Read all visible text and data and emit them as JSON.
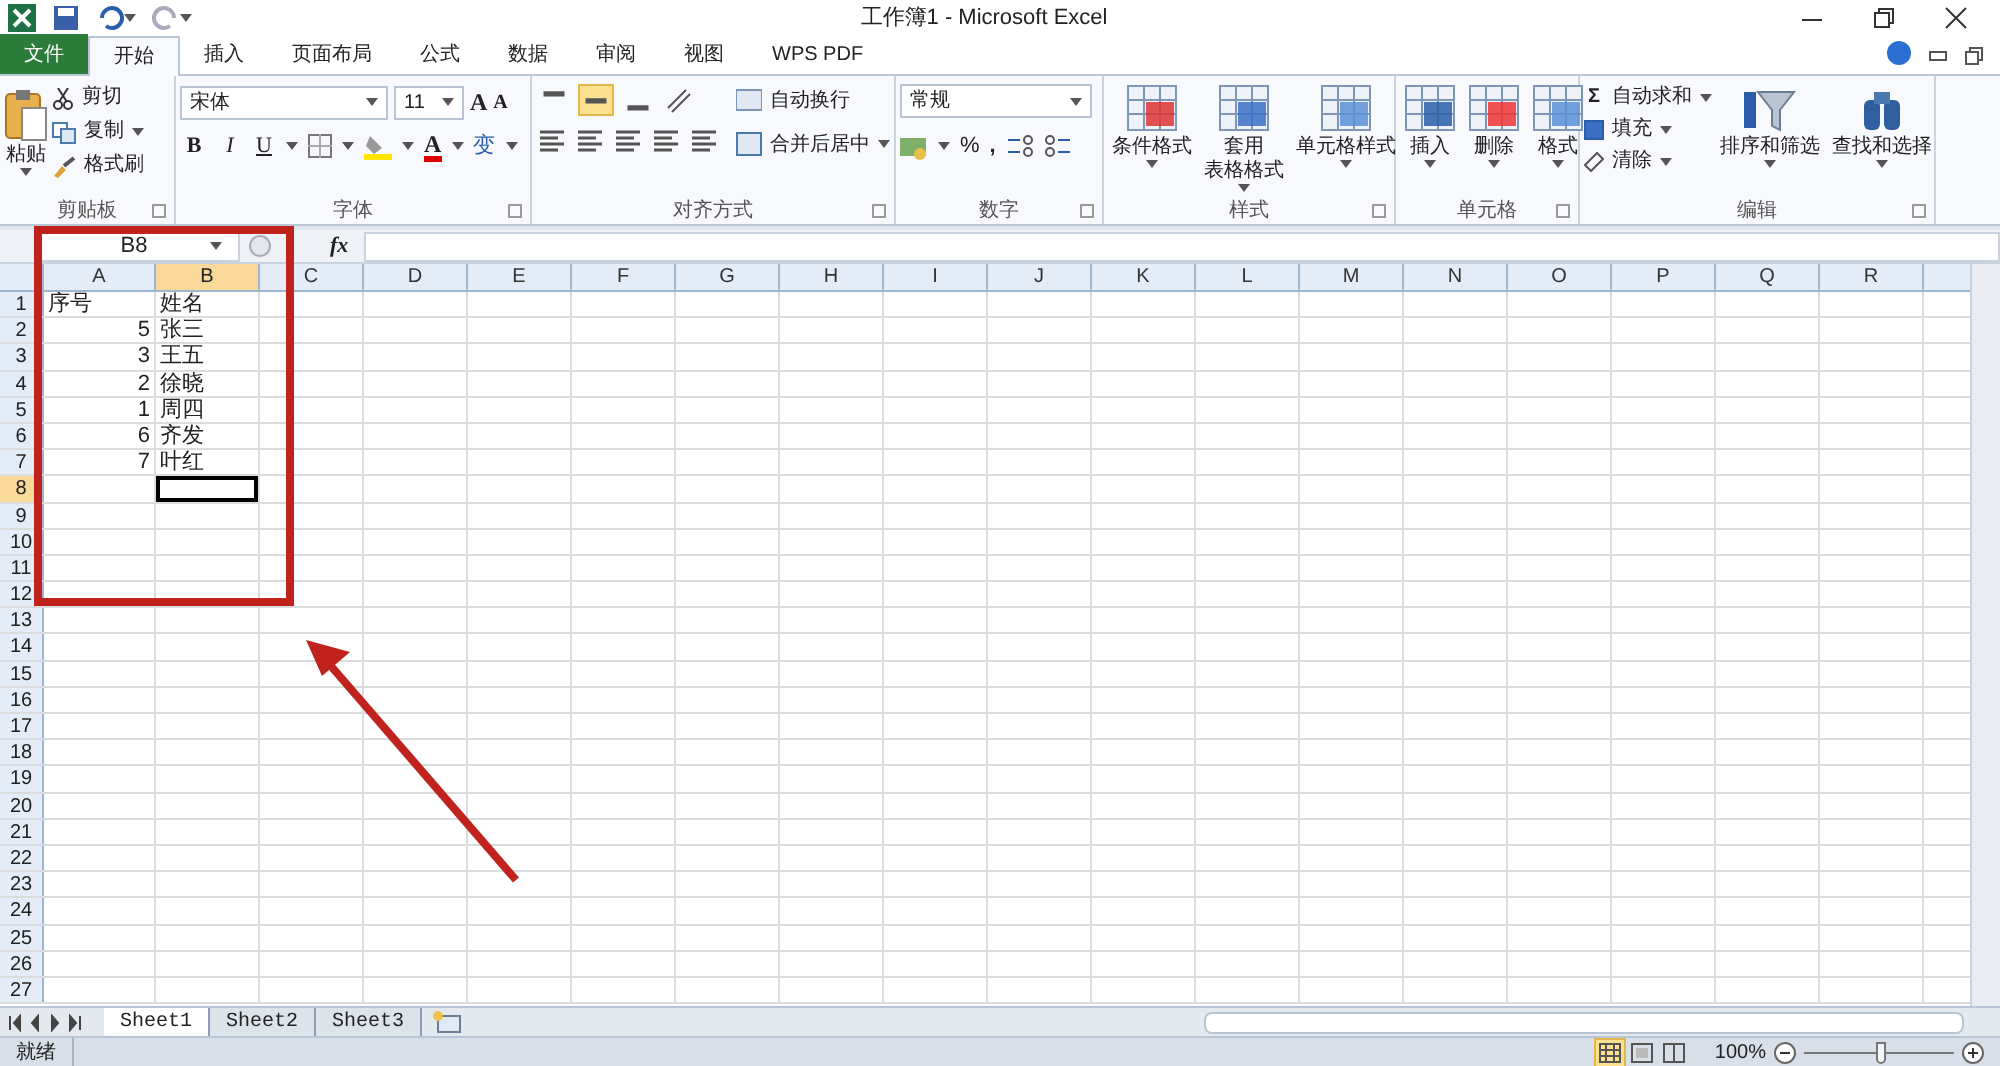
{
  "title": "工作簿1 - Microsoft Excel",
  "tabs": [
    {
      "label": "文件",
      "kind": "file",
      "selected": false
    },
    {
      "label": "开始",
      "kind": "tab",
      "selected": true
    },
    {
      "label": "插入",
      "kind": "tab",
      "selected": false
    },
    {
      "label": "页面布局",
      "kind": "tab",
      "selected": false
    },
    {
      "label": "公式",
      "kind": "tab",
      "selected": false
    },
    {
      "label": "数据",
      "kind": "tab",
      "selected": false
    },
    {
      "label": "审阅",
      "kind": "tab",
      "selected": false
    },
    {
      "label": "视图",
      "kind": "tab",
      "selected": false
    },
    {
      "label": "WPS PDF",
      "kind": "tab",
      "selected": false
    }
  ],
  "ribbon": {
    "clipboard": {
      "label": "剪贴板",
      "paste": "粘贴",
      "cut": "剪切",
      "copy": "复制",
      "format_painter": "格式刷"
    },
    "font": {
      "label": "字体",
      "font_name": "宋体",
      "font_size": "11",
      "grow_font": "A",
      "shrink_font": "A",
      "bold": "B",
      "italic": "I",
      "underline": "U",
      "font_color": "A",
      "phonetic": "变"
    },
    "alignment": {
      "label": "对齐方式",
      "wrap": "自动换行",
      "merge": "合并后居中",
      "middle_align_selected": true
    },
    "number": {
      "label": "数字",
      "format": "常规",
      "percent": "%",
      "comma": ","
    },
    "styles": {
      "label": "样式",
      "buttons": [
        [
          "条件格式"
        ],
        [
          "套用",
          "表格格式"
        ],
        [
          "单元格样式"
        ]
      ]
    },
    "cells": {
      "label": "单元格",
      "buttons": [
        "插入",
        "删除",
        "格式"
      ]
    },
    "editing": {
      "label": "编辑",
      "autosum_sign": "Σ",
      "autosum": "自动求和",
      "fill": "填充",
      "clear": "清除",
      "sort": "排序和筛选",
      "find": "查找和选择"
    }
  },
  "formula_bar": {
    "name_box": "B8",
    "fx": "fx"
  },
  "grid": {
    "columns": [
      {
        "label": "A",
        "selected": false
      },
      {
        "label": "B",
        "selected": true
      },
      {
        "label": "C",
        "selected": false
      },
      {
        "label": "D",
        "selected": false
      },
      {
        "label": "E",
        "selected": false
      },
      {
        "label": "F",
        "selected": false
      },
      {
        "label": "G",
        "selected": false
      },
      {
        "label": "H",
        "selected": false
      },
      {
        "label": "I",
        "selected": false
      },
      {
        "label": "J",
        "selected": false
      },
      {
        "label": "K",
        "selected": false
      },
      {
        "label": "L",
        "selected": false
      },
      {
        "label": "M",
        "selected": false
      },
      {
        "label": "N",
        "selected": false
      },
      {
        "label": "O",
        "selected": false
      },
      {
        "label": "P",
        "selected": false
      },
      {
        "label": "Q",
        "selected": false
      },
      {
        "label": "R",
        "selected": false
      }
    ],
    "rows": [
      {
        "label": "1",
        "selected": false,
        "cells": [
          {
            "kind": "text",
            "value": "序号"
          },
          {
            "kind": "text",
            "value": "姓名"
          }
        ]
      },
      {
        "label": "2",
        "selected": false,
        "cells": [
          {
            "kind": "number",
            "value": "5"
          },
          {
            "kind": "text",
            "value": "张三"
          }
        ]
      },
      {
        "label": "3",
        "selected": false,
        "cells": [
          {
            "kind": "number",
            "value": "3"
          },
          {
            "kind": "text",
            "value": "王五"
          }
        ]
      },
      {
        "label": "4",
        "selected": false,
        "cells": [
          {
            "kind": "number",
            "value": "2"
          },
          {
            "kind": "text",
            "value": "徐晓"
          }
        ]
      },
      {
        "label": "5",
        "selected": false,
        "cells": [
          {
            "kind": "number",
            "value": "1"
          },
          {
            "kind": "text",
            "value": "周四"
          }
        ]
      },
      {
        "label": "6",
        "selected": false,
        "cells": [
          {
            "kind": "number",
            "value": "6"
          },
          {
            "kind": "text",
            "value": "齐发"
          }
        ]
      },
      {
        "label": "7",
        "selected": false,
        "cells": [
          {
            "kind": "number",
            "value": "7"
          },
          {
            "kind": "text",
            "value": "叶红"
          }
        ]
      },
      {
        "label": "8",
        "selected": true
      },
      {
        "label": "9",
        "selected": false
      },
      {
        "label": "10",
        "selected": false
      },
      {
        "label": "11",
        "selected": false
      },
      {
        "label": "12",
        "selected": false
      },
      {
        "label": "13",
        "selected": false
      },
      {
        "label": "14",
        "selected": false
      },
      {
        "label": "15",
        "selected": false
      },
      {
        "label": "16",
        "selected": false
      },
      {
        "label": "17",
        "selected": false
      },
      {
        "label": "18",
        "selected": false
      },
      {
        "label": "19",
        "selected": false
      },
      {
        "label": "20",
        "selected": false
      },
      {
        "label": "21",
        "selected": false
      },
      {
        "label": "22",
        "selected": false
      },
      {
        "label": "23",
        "selected": false
      },
      {
        "label": "24",
        "selected": false
      },
      {
        "label": "25",
        "selected": false
      },
      {
        "label": "26",
        "selected": false
      },
      {
        "label": "27",
        "selected": false
      }
    ]
  },
  "sheet_tabs": [
    {
      "label": "Sheet1",
      "selected": true
    },
    {
      "label": "Sheet2",
      "selected": false
    },
    {
      "label": "Sheet3",
      "selected": false
    }
  ],
  "status_bar": {
    "status": "就绪",
    "views": [
      {
        "kind": "normal",
        "selected": true
      },
      {
        "kind": "page_layout",
        "selected": false
      },
      {
        "kind": "page_break",
        "selected": false
      }
    ],
    "zoom": "100%",
    "zoom_slider": {
      "level": 0.5
    }
  }
}
